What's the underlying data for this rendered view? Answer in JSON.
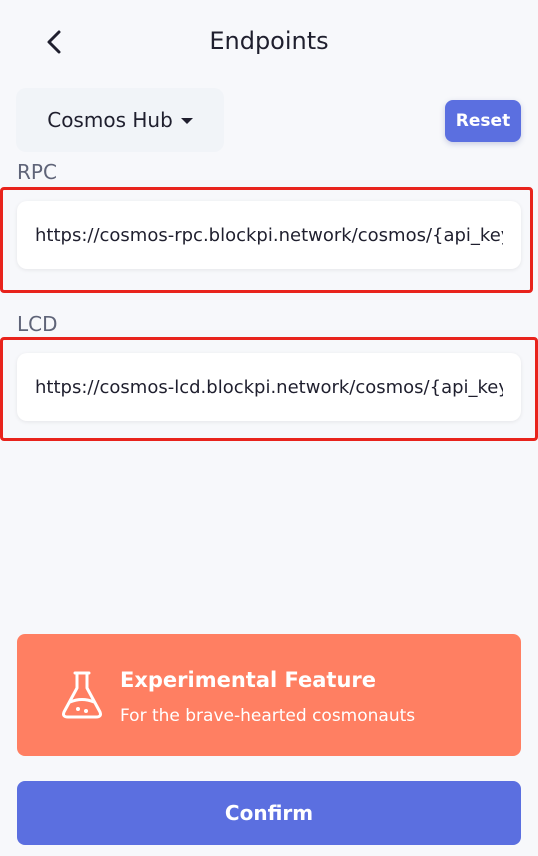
{
  "header": {
    "title": "Endpoints",
    "back_icon": "chevron-left-icon"
  },
  "chain_selector": {
    "selected": "Cosmos Hub",
    "caret_icon": "caret-down-icon"
  },
  "reset": {
    "label": "Reset",
    "color": "#5b6fe0"
  },
  "rpc": {
    "label": "RPC",
    "value": "https://cosmos-rpc.blockpi.network/cosmos/{api_key}"
  },
  "lcd": {
    "label": "LCD",
    "value": "https://cosmos-lcd.blockpi.network/cosmos/{api_key}"
  },
  "experimental": {
    "icon": "flask-icon",
    "title": "Experimental Feature",
    "subtitle": "For the brave-hearted cosmonauts",
    "color": "#ff7f62"
  },
  "confirm": {
    "label": "Confirm",
    "color": "#5b6fe0"
  },
  "highlight_color": "#e8231c"
}
